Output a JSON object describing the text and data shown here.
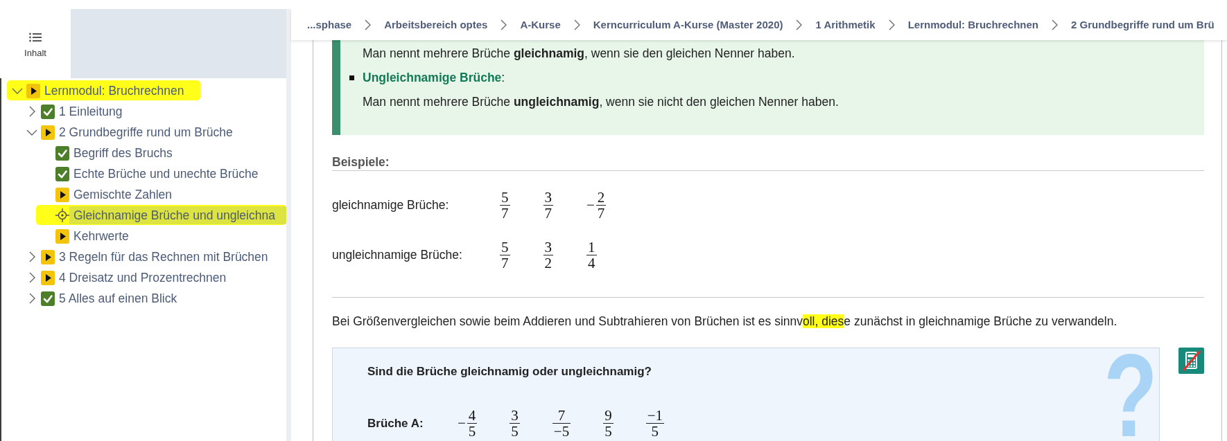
{
  "sidebar": {
    "tabs": [
      {
        "label": "Inhalt",
        "selected": true
      }
    ],
    "tree": [
      {
        "label": "Lernmodul: Bruchrechnen",
        "kind": "started",
        "expanded": true,
        "selected": false,
        "highlighted": true,
        "children": [
          {
            "label": "1 Einleitung",
            "kind": "done",
            "expanded": false,
            "selected": false,
            "highlighted": false
          },
          {
            "label": "2 Grundbegriffe rund um Brüche",
            "kind": "started",
            "expanded": true,
            "selected": false,
            "highlighted": false,
            "children": [
              {
                "label": "Begriff des Bruchs",
                "kind": "done",
                "selected": false,
                "highlighted": false
              },
              {
                "label": "Echte Brüche und unechte Brüche",
                "kind": "done",
                "selected": false,
                "highlighted": false
              },
              {
                "label": "Gemischte Zahlen",
                "kind": "started",
                "selected": false,
                "highlighted": false
              },
              {
                "label": "Gleichnamige Brüche und ungleichna",
                "kind": "current",
                "selected": true,
                "highlighted": true
              },
              {
                "label": "Kehrwerte",
                "kind": "started",
                "selected": false,
                "highlighted": false
              }
            ]
          },
          {
            "label": "3 Regeln für das Rechnen mit Brüchen",
            "kind": "started",
            "expanded": false,
            "selected": false,
            "highlighted": false
          },
          {
            "label": "4 Dreisatz und Prozentrechnen",
            "kind": "started",
            "expanded": false,
            "selected": false,
            "highlighted": false
          },
          {
            "label": "5 Alles auf einen Blick",
            "kind": "done",
            "expanded": false,
            "selected": false,
            "highlighted": false
          }
        ]
      }
    ]
  },
  "breadcrumb": [
    "...sphase",
    "Arbeitsbereich optes",
    "A-Kurse",
    "Kerncurriculum A-Kurse (Master 2020)",
    "1 Arithmetik",
    "Lernmodul: Bruchrechnen",
    "2 Grundbegriffe rund um Brü"
  ],
  "definition_box": {
    "lines": [
      {
        "kind": "text",
        "text": "Man nennt mehrere Brüche **gleichnamig**, wenn sie den gleichen Nenner haben."
      },
      {
        "kind": "term",
        "text": "**Ungleichnamige Brüche**:"
      },
      {
        "kind": "text",
        "text": "Man nennt mehrere Brüche **ungleichnamig**, wenn sie nicht den gleichen Nenner haben."
      }
    ]
  },
  "examples": {
    "heading": "Beispiele:",
    "rows": [
      {
        "label": "gleichnamige Brüche:",
        "fractions": [
          {
            "numerator": "5",
            "denominator": "7"
          },
          {
            "numerator": "3",
            "denominator": "7"
          },
          {
            "sign": "−",
            "numerator": "2",
            "denominator": "7"
          }
        ]
      },
      {
        "label": "ungleichnamige Brüche:",
        "fractions": [
          {
            "numerator": "5",
            "denominator": "7"
          },
          {
            "numerator": "3",
            "denominator": "2"
          },
          {
            "numerator": "1",
            "denominator": "4"
          }
        ]
      }
    ]
  },
  "note": [
    {
      "text": "Bei Größenvergleichen sowie beim Addieren und Subtrahieren von Brüchen ist es sinnv",
      "highlighted": false
    },
    {
      "text": "oll, dies",
      "highlighted": true
    },
    {
      "text": "e zunächst in gleichnamige Brüche zu verwandeln.",
      "highlighted": false
    }
  ],
  "exercise": {
    "question": "Sind die Brüche gleichnamig oder ungleichnamig?",
    "decoration_glyph": "?",
    "rows": [
      {
        "label": "Brüche A:",
        "fractions": [
          {
            "sign": "−",
            "numerator": "4",
            "denominator": "5"
          },
          {
            "numerator": "3",
            "denominator": "5"
          },
          {
            "numerator": "7",
            "denominator": "−5"
          },
          {
            "numerator": "9",
            "denominator": "5"
          },
          {
            "numerator": "−1",
            "denominator": "5"
          }
        ]
      }
    ]
  }
}
